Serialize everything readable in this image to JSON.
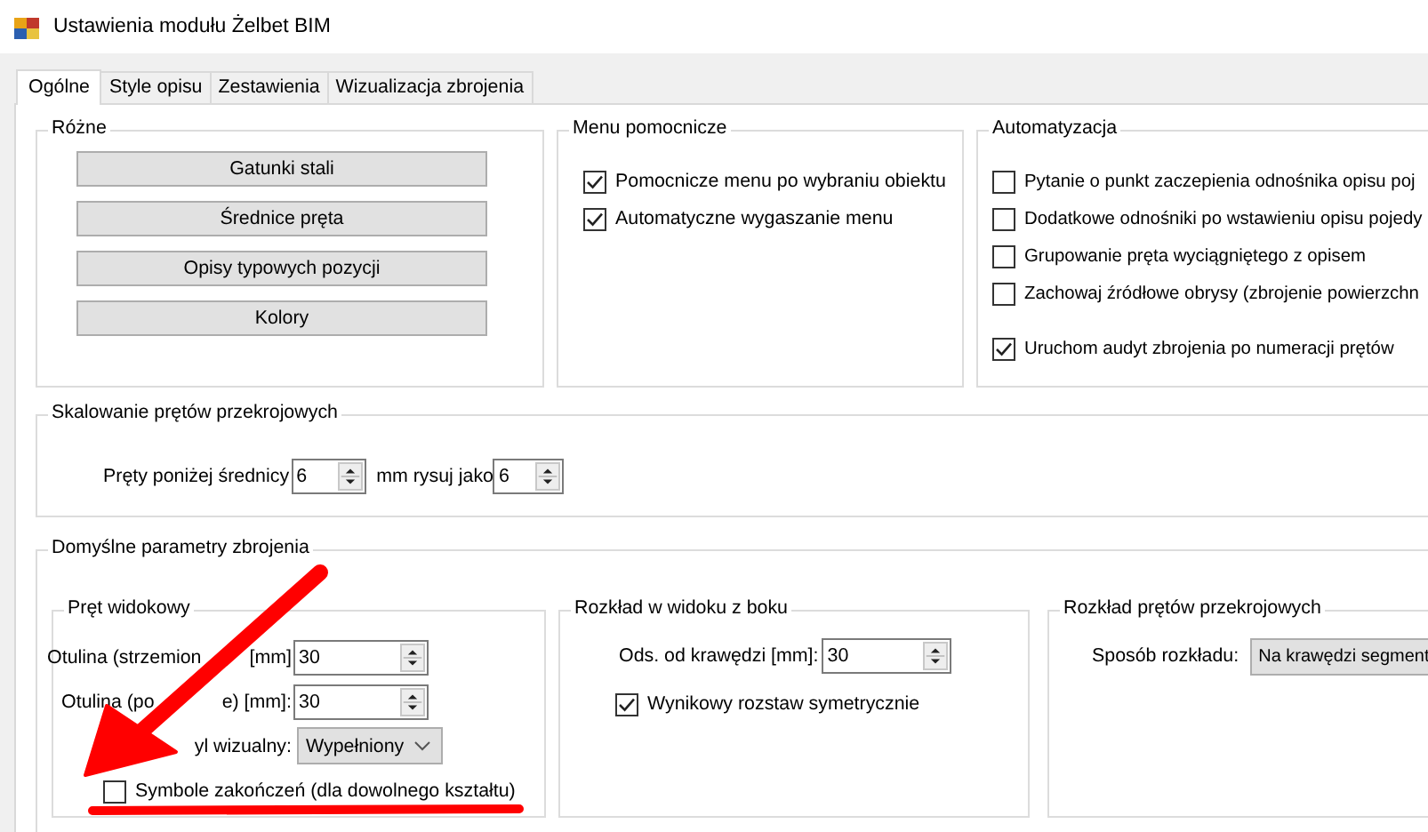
{
  "window": {
    "title": "Ustawienia modułu Żelbet BIM"
  },
  "tabs": [
    {
      "label": "Ogólne",
      "selected": true
    },
    {
      "label": "Style opisu",
      "selected": false
    },
    {
      "label": "Zestawienia",
      "selected": false
    },
    {
      "label": "Wizualizacja zbrojenia",
      "selected": false
    }
  ],
  "various": {
    "title": "Różne",
    "buttons": [
      "Gatunki stali",
      "Średnice pręta",
      "Opisy typowych pozycji",
      "Kolory"
    ]
  },
  "helper_menu": {
    "title": "Menu pomocnicze",
    "options": [
      {
        "label": "Pomocnicze menu po wybraniu obiektu",
        "checked": true
      },
      {
        "label": "Automatyczne wygaszanie menu",
        "checked": true
      }
    ]
  },
  "automation": {
    "title": "Automatyzacja",
    "options": [
      {
        "label": "Pytanie o punkt zaczepienia odnośnika opisu poj",
        "checked": false
      },
      {
        "label": "Dodatkowe odnośniki po wstawieniu opisu pojedy",
        "checked": false
      },
      {
        "label": "Grupowanie pręta wyciągniętego z opisem",
        "checked": false
      },
      {
        "label": "Zachowaj źródłowe obrysy (zbrojenie powierzchn",
        "checked": false
      },
      {
        "label": "Uruchom audyt zbrojenia po numeracji prętów",
        "checked": true
      }
    ]
  },
  "scaling": {
    "title": "Skalowanie prętów przekrojowych",
    "label": "Pręty poniżej średnicy",
    "value": "6",
    "unit_label": "mm rysuj jako",
    "value2": "6"
  },
  "defaults": {
    "title": "Domyślne parametry zbrojenia",
    "view_bar": {
      "title": "Pręt widokowy",
      "fields": [
        {
          "kind": "spin",
          "label_parts": [
            "Otulina (strzemion",
            "[mm]"
          ],
          "value": "30"
        },
        {
          "kind": "spin",
          "label_parts": [
            "Otulina (po",
            "e) [mm]:"
          ],
          "value": "30"
        },
        {
          "kind": "combo",
          "label_parts": [
            "yl wizualny:"
          ],
          "value": "Wypełniony"
        }
      ],
      "end_symbols": {
        "label": "Symbole zakończeń (dla dowolnego kształtu)",
        "checked": false
      }
    },
    "side_view": {
      "title": "Rozkład w widoku z boku",
      "field": {
        "label": "Ods. od krawędzi [mm]:",
        "value": "30"
      },
      "option": {
        "label": "Wynikowy rozstaw symetrycznie",
        "checked": true
      }
    },
    "cross_bars": {
      "title": "Rozkład prętów przekrojowych",
      "field": {
        "label": "Sposób rozkładu:",
        "value": "Na krawędzi segment"
      }
    }
  }
}
